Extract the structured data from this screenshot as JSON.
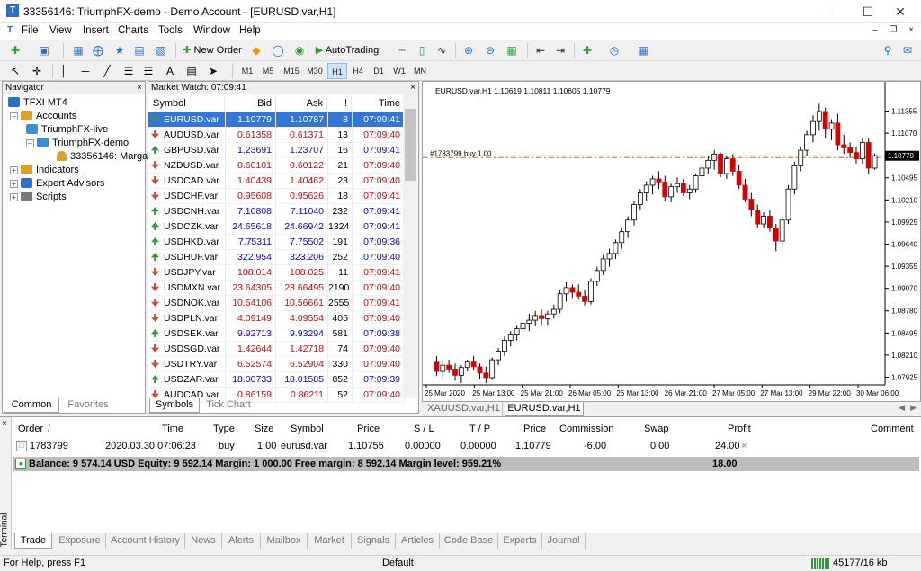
{
  "window": {
    "title": "33356146: TriumphFX-demo - Demo Account - [EURUSD.var,H1]",
    "logo_glyph": "T"
  },
  "menu": [
    "File",
    "View",
    "Insert",
    "Charts",
    "Tools",
    "Window",
    "Help"
  ],
  "toolbar": {
    "new_order": "New Order",
    "autotrading": "AutoTrading",
    "timeframes": [
      "M1",
      "M5",
      "M15",
      "M30",
      "H1",
      "H4",
      "D1",
      "W1",
      "MN"
    ],
    "active_tf": "H1"
  },
  "navigator": {
    "title": "Navigator",
    "items": [
      "TFXI MT4",
      "Accounts",
      "TriumphFX-live",
      "TriumphFX-demo",
      "33356146: Marga",
      "Indicators",
      "Expert Advisors",
      "Scripts"
    ],
    "tabs": [
      "Common",
      "Favorites"
    ]
  },
  "market_watch": {
    "title": "Market Watch: 07:09:41",
    "columns": [
      "Symbol",
      "Bid",
      "Ask",
      "!",
      "Time"
    ],
    "rows": [
      {
        "dir": "up",
        "symbol": "EURUSD.var",
        "bid": "1.10779",
        "ask": "1.10787",
        "spread": "8",
        "time": "07:09:41",
        "color": "blue",
        "selected": true
      },
      {
        "dir": "down",
        "symbol": "AUDUSD.var",
        "bid": "0.61358",
        "ask": "0.61371",
        "spread": "13",
        "time": "07:09:40",
        "color": "red"
      },
      {
        "dir": "up",
        "symbol": "GBPUSD.var",
        "bid": "1.23691",
        "ask": "1.23707",
        "spread": "16",
        "time": "07:09:41",
        "color": "blue"
      },
      {
        "dir": "down",
        "symbol": "NZDUSD.var",
        "bid": "0.60101",
        "ask": "0.60122",
        "spread": "21",
        "time": "07:09:40",
        "color": "red"
      },
      {
        "dir": "down",
        "symbol": "USDCAD.var",
        "bid": "1.40439",
        "ask": "1.40462",
        "spread": "23",
        "time": "07:09:40",
        "color": "red"
      },
      {
        "dir": "down",
        "symbol": "USDCHF.var",
        "bid": "0.95608",
        "ask": "0.95626",
        "spread": "18",
        "time": "07:09:41",
        "color": "red"
      },
      {
        "dir": "up",
        "symbol": "USDCNH.var",
        "bid": "7.10808",
        "ask": "7.11040",
        "spread": "232",
        "time": "07:09:41",
        "color": "blue"
      },
      {
        "dir": "up",
        "symbol": "USDCZK.var",
        "bid": "24.65618",
        "ask": "24.66942",
        "spread": "1324",
        "time": "07:09:41",
        "color": "blue"
      },
      {
        "dir": "up",
        "symbol": "USDHKD.var",
        "bid": "7.75311",
        "ask": "7.75502",
        "spread": "191",
        "time": "07:09:36",
        "color": "blue"
      },
      {
        "dir": "up",
        "symbol": "USDHUF.var",
        "bid": "322.954",
        "ask": "323.206",
        "spread": "252",
        "time": "07:09:40",
        "color": "blue"
      },
      {
        "dir": "down",
        "symbol": "USDJPY.var",
        "bid": "108.014",
        "ask": "108.025",
        "spread": "11",
        "time": "07:09:41",
        "color": "red"
      },
      {
        "dir": "down",
        "symbol": "USDMXN.var",
        "bid": "23.64305",
        "ask": "23.66495",
        "spread": "2190",
        "time": "07:09:40",
        "color": "red"
      },
      {
        "dir": "down",
        "symbol": "USDNOK.var",
        "bid": "10.54106",
        "ask": "10.56661",
        "spread": "2555",
        "time": "07:09:41",
        "color": "red"
      },
      {
        "dir": "down",
        "symbol": "USDPLN.var",
        "bid": "4.09149",
        "ask": "4.09554",
        "spread": "405",
        "time": "07:09:40",
        "color": "red"
      },
      {
        "dir": "up",
        "symbol": "USDSEK.var",
        "bid": "9.92713",
        "ask": "9.93294",
        "spread": "581",
        "time": "07:09:38",
        "color": "blue"
      },
      {
        "dir": "down",
        "symbol": "USDSGD.var",
        "bid": "1.42644",
        "ask": "1.42718",
        "spread": "74",
        "time": "07:09:40",
        "color": "red"
      },
      {
        "dir": "down",
        "symbol": "USDTRY.var",
        "bid": "6.52574",
        "ask": "6.52904",
        "spread": "330",
        "time": "07:09:40",
        "color": "red"
      },
      {
        "dir": "up",
        "symbol": "USDZAR.var",
        "bid": "18.00733",
        "ask": "18.01585",
        "spread": "852",
        "time": "07:09:39",
        "color": "blue"
      },
      {
        "dir": "down",
        "symbol": "AUDCAD.var",
        "bid": "0.86159",
        "ask": "0.86211",
        "spread": "52",
        "time": "07:09:40",
        "color": "red"
      }
    ],
    "tabs": [
      "Symbols",
      "Tick Chart"
    ]
  },
  "chart": {
    "header": "EURUSD.var,H1  1.10619 1.10811 1.10605 1.10779",
    "trade_label": "#1783799 buy 1.00",
    "price_label": "1.10779",
    "tabs": [
      "XAUUSD.var,H1",
      "EURUSD.var,H1"
    ],
    "active_tab": 1
  },
  "chart_data": {
    "type": "candlestick",
    "y_ticks": [
      "1.11355",
      "1.11070",
      "1.10779",
      "1.10495",
      "1.10210",
      "1.09925",
      "1.09640",
      "1.09355",
      "1.09070",
      "1.08780",
      "1.08495",
      "1.08210",
      "1.07925"
    ],
    "x_ticks": [
      "25 Mar 2020",
      "25 Mar 13:00",
      "25 Mar 21:00",
      "26 Mar 05:00",
      "26 Mar 13:00",
      "26 Mar 21:00",
      "27 Mar 05:00",
      "27 Mar 13:00",
      "29 Mar 22:00",
      "30 Mar 06:00"
    ],
    "ylim": [
      1.0785,
      1.115
    ],
    "trade_open": 1.10755,
    "last_price": 1.10779,
    "candles": [
      [
        1.0812,
        1.082,
        1.0794,
        1.08
      ],
      [
        1.08,
        1.0813,
        1.079,
        1.0808
      ],
      [
        1.0808,
        1.0815,
        1.0798,
        1.0803
      ],
      [
        1.0803,
        1.081,
        1.0788,
        1.0795
      ],
      [
        1.0795,
        1.0808,
        1.0785,
        1.0805
      ],
      [
        1.0805,
        1.0815,
        1.08,
        1.0812
      ],
      [
        1.0812,
        1.082,
        1.0801,
        1.0806
      ],
      [
        1.0806,
        1.081,
        1.079,
        1.0798
      ],
      [
        1.0798,
        1.0806,
        1.0785,
        1.0792
      ],
      [
        1.0792,
        1.0818,
        1.0789,
        1.0815
      ],
      [
        1.0815,
        1.083,
        1.0808,
        1.0826
      ],
      [
        1.0826,
        1.0845,
        1.082,
        1.084
      ],
      [
        1.084,
        1.0852,
        1.0832,
        1.0848
      ],
      [
        1.0848,
        1.086,
        1.084,
        1.0855
      ],
      [
        1.0855,
        1.0868,
        1.0848,
        1.0862
      ],
      [
        1.0862,
        1.0874,
        1.0852,
        1.0866
      ],
      [
        1.0866,
        1.0878,
        1.0858,
        1.0872
      ],
      [
        1.0872,
        1.088,
        1.086,
        1.0868
      ],
      [
        1.0868,
        1.0878,
        1.086,
        1.0874
      ],
      [
        1.0874,
        1.0886,
        1.0868,
        1.088
      ],
      [
        1.088,
        1.0905,
        1.0875,
        1.09
      ],
      [
        1.09,
        1.0915,
        1.089,
        1.0908
      ],
      [
        1.0908,
        1.0912,
        1.0895,
        1.0902
      ],
      [
        1.0902,
        1.0912,
        1.0893,
        1.0897
      ],
      [
        1.0897,
        1.0905,
        1.0885,
        1.089
      ],
      [
        1.089,
        1.092,
        1.0886,
        1.0916
      ],
      [
        1.0916,
        1.0935,
        1.091,
        1.093
      ],
      [
        1.093,
        1.095,
        1.0924,
        1.0945
      ],
      [
        1.0945,
        1.0958,
        1.0935,
        1.0952
      ],
      [
        1.0952,
        1.097,
        1.0945,
        1.0966
      ],
      [
        1.0966,
        1.0985,
        1.0958,
        1.098
      ],
      [
        1.098,
        1.1,
        1.0972,
        1.0995
      ],
      [
        1.0995,
        1.102,
        1.0988,
        1.1015
      ],
      [
        1.1015,
        1.1035,
        1.1008,
        1.103
      ],
      [
        1.103,
        1.1045,
        1.102,
        1.104
      ],
      [
        1.104,
        1.1052,
        1.1028,
        1.1048
      ],
      [
        1.1048,
        1.1058,
        1.1035,
        1.1044
      ],
      [
        1.1044,
        1.1052,
        1.102,
        1.1025
      ],
      [
        1.1025,
        1.1042,
        1.1018,
        1.1038
      ],
      [
        1.1038,
        1.105,
        1.103,
        1.1042
      ],
      [
        1.1042,
        1.1048,
        1.1026,
        1.103
      ],
      [
        1.103,
        1.104,
        1.1022,
        1.1035
      ],
      [
        1.1035,
        1.1055,
        1.103,
        1.1052
      ],
      [
        1.1052,
        1.1068,
        1.1045,
        1.1062
      ],
      [
        1.1062,
        1.1078,
        1.1055,
        1.1072
      ],
      [
        1.1072,
        1.1085,
        1.106,
        1.108
      ],
      [
        1.108,
        1.1082,
        1.105,
        1.1055
      ],
      [
        1.1055,
        1.1078,
        1.1048,
        1.1074
      ],
      [
        1.1074,
        1.108,
        1.1052,
        1.1058
      ],
      [
        1.1058,
        1.1066,
        1.1035,
        1.104
      ],
      [
        1.104,
        1.1048,
        1.1018,
        1.1022
      ],
      [
        1.1022,
        1.103,
        1.1,
        1.1008
      ],
      [
        1.1008,
        1.1015,
        1.0985,
        1.099
      ],
      [
        1.099,
        1.1005,
        1.0985,
        1.1
      ],
      [
        1.1,
        1.1008,
        1.098,
        1.0985
      ],
      [
        1.0985,
        1.099,
        1.0955,
        1.0968
      ],
      [
        1.0968,
        1.1,
        1.0962,
        1.0995
      ],
      [
        1.0995,
        1.104,
        1.099,
        1.1035
      ],
      [
        1.1035,
        1.107,
        1.1028,
        1.1065
      ],
      [
        1.1065,
        1.109,
        1.1058,
        1.1085
      ],
      [
        1.1085,
        1.111,
        1.1078,
        1.1105
      ],
      [
        1.1105,
        1.113,
        1.1095,
        1.1122
      ],
      [
        1.1122,
        1.1145,
        1.111,
        1.1135
      ],
      [
        1.1135,
        1.114,
        1.11,
        1.1112
      ],
      [
        1.1112,
        1.1125,
        1.1098,
        1.112
      ],
      [
        1.112,
        1.1132,
        1.1085,
        1.1092
      ],
      [
        1.1092,
        1.1105,
        1.108,
        1.1088
      ],
      [
        1.1088,
        1.1095,
        1.1075,
        1.1082
      ],
      [
        1.1082,
        1.109,
        1.1068,
        1.1074
      ],
      [
        1.1074,
        1.11,
        1.1068,
        1.1095
      ],
      [
        1.1095,
        1.11,
        1.1055,
        1.1062
      ],
      [
        1.1062,
        1.1081,
        1.106,
        1.1078
      ]
    ]
  },
  "terminal": {
    "side_label": "Terminal",
    "columns": [
      "Order",
      "/",
      "Time",
      "Type",
      "Size",
      "Symbol",
      "Price",
      "S / L",
      "T / P",
      "Price",
      "Commission",
      "Swap",
      "Profit",
      "Comment"
    ],
    "order": {
      "order": "1783799",
      "time": "2020.03.30 07:06:23",
      "type": "buy",
      "size": "1.00",
      "symbol": "eurusd.var",
      "price": "1.10755",
      "sl": "0.00000",
      "tp": "0.00000",
      "cur_price": "1.10779",
      "commission": "-6.00",
      "swap": "0.00",
      "profit": "24.00",
      "close": "×"
    },
    "balance_line": "Balance: 9 574.14 USD  Equity: 9 592.14  Margin: 1 000.00  Free margin: 8 592.14  Margin level: 959.21%",
    "balance_profit": "18.00",
    "tabs": [
      "Trade",
      "Exposure",
      "Account History",
      "News",
      "Alerts",
      "Mailbox",
      "Market",
      "Signals",
      "Articles",
      "Code Base",
      "Experts",
      "Journal"
    ]
  },
  "status": {
    "help": "For Help, press F1",
    "profile": "Default",
    "traffic": "45177/16 kb"
  },
  "colors": {
    "bull": "#ffffff",
    "bear": "#d90000",
    "bid_up": "#0000ff",
    "bid_down": "#e00000",
    "selection": "#3476d8",
    "trade_line": "#d2691e"
  }
}
